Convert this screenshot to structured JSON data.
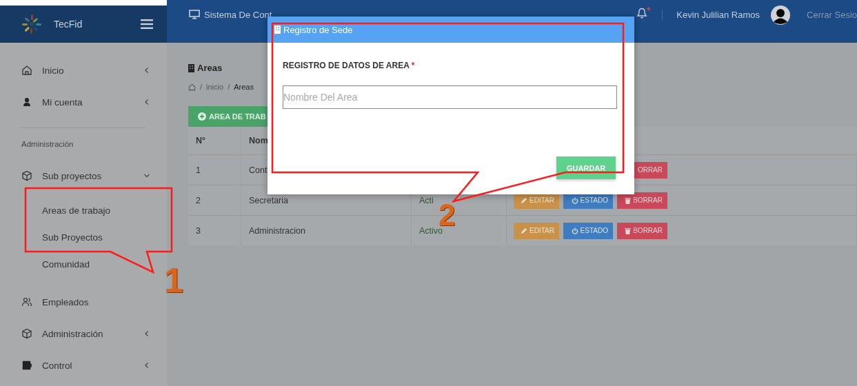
{
  "sidebar": {
    "brand": "TecFid",
    "items": [
      {
        "kind": "menu",
        "label": "Inicio",
        "expanded": false
      },
      {
        "kind": "menu",
        "label": "Mi cuenta",
        "expanded": false
      },
      {
        "kind": "section",
        "label": "Administración"
      },
      {
        "kind": "menu",
        "label": "Sub proyectos",
        "expanded": true,
        "children": [
          {
            "label": "Areas de trabajo"
          },
          {
            "label": "Sub Proyectos"
          },
          {
            "label": "Comunidad"
          }
        ]
      },
      {
        "kind": "link",
        "label": "Empleados"
      },
      {
        "kind": "menu",
        "label": "Administración",
        "expanded": false
      },
      {
        "kind": "menu",
        "label": "Control",
        "expanded": false
      }
    ]
  },
  "header": {
    "title": "Sistema De Cont",
    "user": "Kevin Julilian Ramos",
    "logout": "Cerrar Sesio"
  },
  "page": {
    "title": "Areas",
    "breadcrumb": [
      {
        "separator": "/",
        "label": "inicio"
      },
      {
        "separator": "/",
        "label": "Areas"
      }
    ],
    "add_button": "AREA DE TRAB"
  },
  "table": {
    "columns": [
      "N°",
      "Nom"
    ],
    "rows": [
      {
        "number": "1",
        "name": "Cont",
        "actions": [
          {
            "kind": "delete",
            "label": "ORRAR"
          }
        ]
      },
      {
        "number": "2",
        "name": "Secretaria",
        "status": "Acti",
        "actions": [
          {
            "kind": "edit",
            "label": "EDITAR"
          },
          {
            "kind": "state",
            "label": "ESTADO"
          },
          {
            "kind": "delete",
            "label": "BORRAR"
          }
        ]
      },
      {
        "number": "3",
        "name": "Administracion",
        "status": "Activo",
        "actions": [
          {
            "kind": "edit",
            "label": "EDITAR"
          },
          {
            "kind": "state",
            "label": "ESTADO"
          },
          {
            "kind": "delete",
            "label": "BORRAR"
          }
        ]
      }
    ]
  },
  "modal": {
    "title": "Registro de Sede",
    "label": "REGISTRO DE DATOS DE AREA",
    "required_mark": "*",
    "placeholder": "Nombre Del Area",
    "button": "GUARDAR"
  },
  "annotations": [
    {
      "number": "1"
    },
    {
      "number": "2"
    }
  ]
}
